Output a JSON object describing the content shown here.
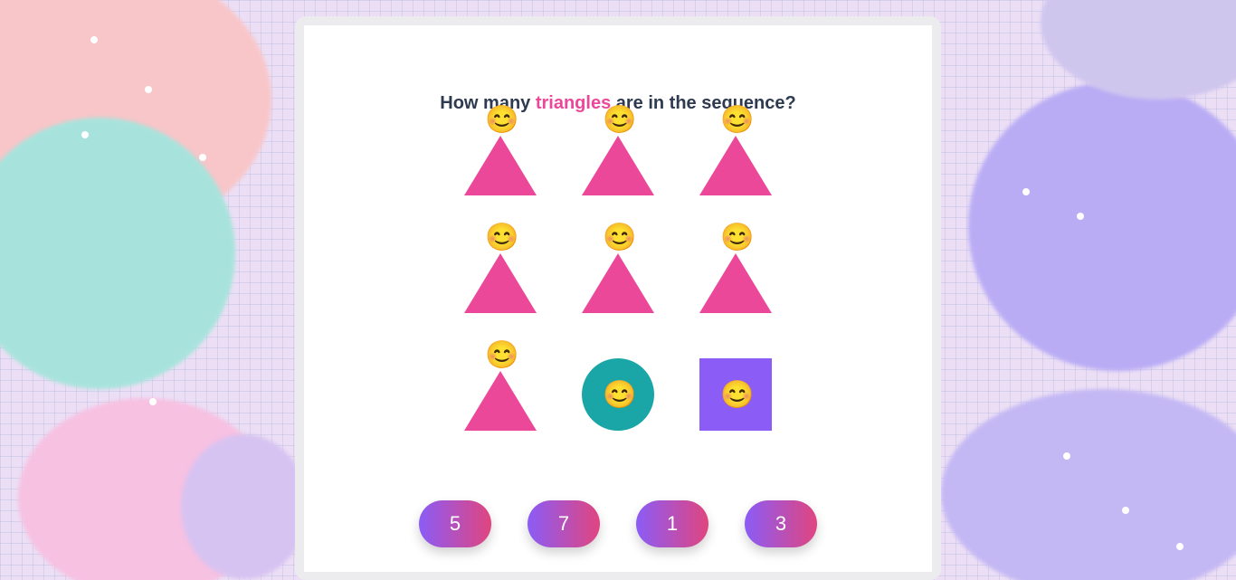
{
  "question": {
    "prefix": "How many ",
    "highlight": "triangles",
    "suffix": " are in the sequence?"
  },
  "grid": {
    "rows": [
      [
        {
          "shape": "triangle",
          "face": "😊"
        },
        {
          "shape": "triangle",
          "face": "😊"
        },
        {
          "shape": "triangle",
          "face": "😊"
        }
      ],
      [
        {
          "shape": "triangle",
          "face": "😊"
        },
        {
          "shape": "triangle",
          "face": "😊"
        },
        {
          "shape": "triangle",
          "face": "😊"
        }
      ],
      [
        {
          "shape": "triangle",
          "face": "😊"
        },
        {
          "shape": "circle",
          "face": "😊"
        },
        {
          "shape": "square",
          "face": "😊"
        }
      ]
    ]
  },
  "options": [
    "5",
    "7",
    "1",
    "3"
  ],
  "colors": {
    "triangle": "#ec4899",
    "circle": "#1aa6a6",
    "square": "#8b5cf6",
    "question_text": "#2d3a4f",
    "highlight": "#ec4899",
    "button_gradient_start": "#8b5cf6",
    "button_gradient_end": "#e0457f"
  }
}
